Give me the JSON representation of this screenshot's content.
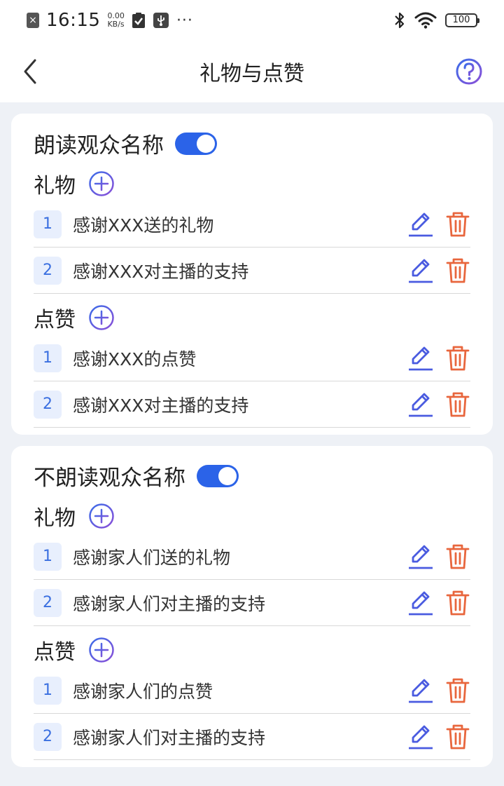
{
  "status_bar": {
    "time": "16:15",
    "net_speed_value": "0.00",
    "net_speed_unit": "KB/s",
    "more": "···",
    "battery": "100"
  },
  "header": {
    "title": "礼物与点赞"
  },
  "sections": [
    {
      "title": "朗读观众名称",
      "toggle_on": true,
      "gift": {
        "title": "礼物",
        "items": [
          {
            "index": "1",
            "text": "感谢XXX送的礼物"
          },
          {
            "index": "2",
            "text": "感谢XXX对主播的支持"
          }
        ]
      },
      "like": {
        "title": "点赞",
        "items": [
          {
            "index": "1",
            "text": "感谢XXX的点赞"
          },
          {
            "index": "2",
            "text": "感谢XXX对主播的支持"
          }
        ]
      }
    },
    {
      "title": "不朗读观众名称",
      "toggle_on": true,
      "gift": {
        "title": "礼物",
        "items": [
          {
            "index": "1",
            "text": "感谢家人们送的礼物"
          },
          {
            "index": "2",
            "text": "感谢家人们对主播的支持"
          }
        ]
      },
      "like": {
        "title": "点赞",
        "items": [
          {
            "index": "1",
            "text": "感谢家人们的点赞"
          },
          {
            "index": "2",
            "text": "感谢家人们对主播的支持"
          }
        ]
      }
    }
  ],
  "colors": {
    "accent": "#2b63e8",
    "edit_icon": "#4a5be0",
    "delete_icon": "#e8663d",
    "index_bg": "#e8effd"
  },
  "icons": {
    "back": "chevron-left-icon",
    "help": "question-circle-icon",
    "add": "plus-circle-icon",
    "edit": "pencil-icon",
    "delete": "trash-icon"
  }
}
